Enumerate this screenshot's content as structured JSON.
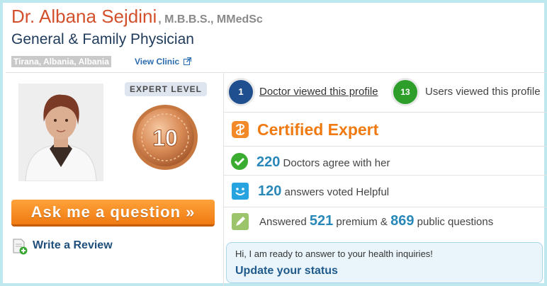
{
  "doctor": {
    "name": "Dr. Albana Sejdini",
    "credentials": ", M.B.B.S., MMedSc",
    "specialty": "General & Family Physician",
    "location": "Tirana, Albania, Albania",
    "view_clinic": "View Clinic"
  },
  "expert": {
    "label": "EXPERT LEVEL",
    "level": "10"
  },
  "actions": {
    "ask": "Ask me a question »",
    "review": "Write a Review"
  },
  "views": {
    "doctors_count": "1",
    "doctors_text": "Doctor viewed this profile",
    "users_count": "13",
    "users_text": "Users viewed this profile"
  },
  "stats": {
    "certified": "Certified Expert",
    "agree_num": "220",
    "agree_text": "Doctors agree with her",
    "helpful_num": "120",
    "helpful_text": "answers voted Helpful",
    "answered_prefix": "Answered",
    "premium_num": "521",
    "premium_text": "premium &",
    "public_num": "869",
    "public_text": "public questions"
  },
  "status": {
    "message": "Hi, I am ready to answer to your health inquiries!",
    "link": "Update your status"
  },
  "colors": {
    "name": "#d2512c",
    "accent_orange": "#f07a12",
    "stat_blue": "#2a88b8",
    "border": "#bfe8ee"
  }
}
